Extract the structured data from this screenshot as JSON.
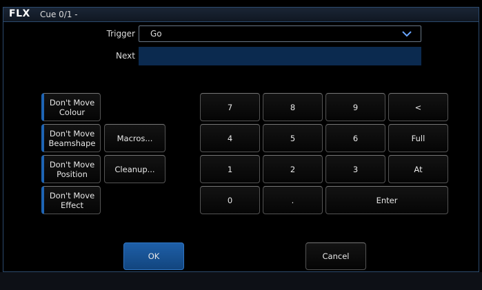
{
  "window": {
    "logo": "FLX",
    "title": "Cue 0/1 -"
  },
  "trigger": {
    "label": "Trigger",
    "value": "Go"
  },
  "next": {
    "label": "Next",
    "value": ""
  },
  "options": [
    {
      "label": "Don't Move Colour"
    },
    {
      "label": "Don't Move Beamshape"
    },
    {
      "label": "Don't Move Position"
    },
    {
      "label": "Don't Move Effect"
    }
  ],
  "actions": {
    "macros": "Macros...",
    "cleanup": "Cleanup..."
  },
  "keypad": {
    "k7": "7",
    "k8": "8",
    "k9": "9",
    "back": "<",
    "k4": "4",
    "k5": "5",
    "k6": "6",
    "full": "Full",
    "k1": "1",
    "k2": "2",
    "k3": "3",
    "at": "At",
    "k0": "0",
    "dot": ".",
    "enter": "Enter"
  },
  "footer": {
    "ok": "OK",
    "cancel": "Cancel"
  }
}
